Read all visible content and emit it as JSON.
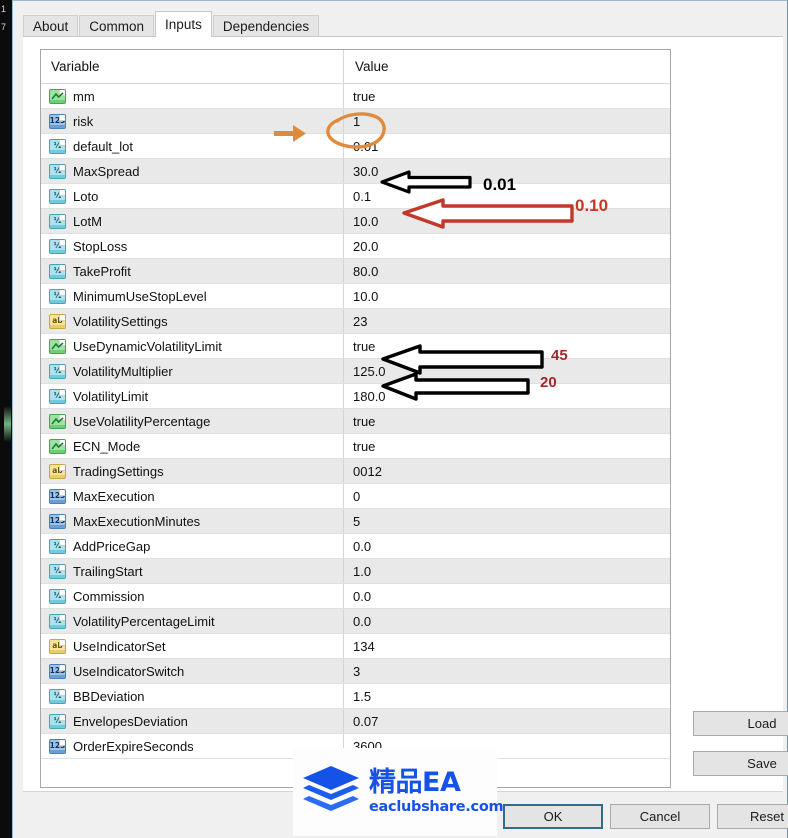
{
  "window": {
    "tabs": [
      {
        "label": "About",
        "active": false
      },
      {
        "label": "Common",
        "active": false
      },
      {
        "label": "Inputs",
        "active": true
      },
      {
        "label": "Dependencies",
        "active": false
      }
    ]
  },
  "table": {
    "headers": {
      "variable": "Variable",
      "value": "Value"
    },
    "rows": [
      {
        "icon": "bool-type-icon",
        "type": "bool",
        "variable": "mm",
        "value": "true"
      },
      {
        "icon": "int-type-icon",
        "type": "int",
        "variable": "risk",
        "value": "1"
      },
      {
        "icon": "double-type-icon",
        "type": "double",
        "variable": "default_lot",
        "value": "0.01"
      },
      {
        "icon": "double-type-icon",
        "type": "double",
        "variable": "MaxSpread",
        "value": "30.0"
      },
      {
        "icon": "double-type-icon",
        "type": "double",
        "variable": "Loto",
        "value": "0.1"
      },
      {
        "icon": "double-type-icon",
        "type": "double",
        "variable": "LotM",
        "value": "10.0"
      },
      {
        "icon": "double-type-icon",
        "type": "double",
        "variable": "StopLoss",
        "value": "20.0"
      },
      {
        "icon": "double-type-icon",
        "type": "double",
        "variable": "TakeProfit",
        "value": "80.0"
      },
      {
        "icon": "double-type-icon",
        "type": "double",
        "variable": "MinimumUseStopLevel",
        "value": "10.0"
      },
      {
        "icon": "string-type-icon",
        "type": "string",
        "variable": "VolatilitySettings",
        "value": "23"
      },
      {
        "icon": "bool-type-icon",
        "type": "bool",
        "variable": "UseDynamicVolatilityLimit",
        "value": "true"
      },
      {
        "icon": "double-type-icon",
        "type": "double",
        "variable": "VolatilityMultiplier",
        "value": "125.0"
      },
      {
        "icon": "double-type-icon",
        "type": "double",
        "variable": "VolatilityLimit",
        "value": "180.0"
      },
      {
        "icon": "bool-type-icon",
        "type": "bool",
        "variable": "UseVolatilityPercentage",
        "value": "true"
      },
      {
        "icon": "bool-type-icon",
        "type": "bool",
        "variable": "ECN_Mode",
        "value": "true"
      },
      {
        "icon": "string-type-icon",
        "type": "string",
        "variable": "TradingSettings",
        "value": "0012"
      },
      {
        "icon": "int-type-icon",
        "type": "int",
        "variable": "MaxExecution",
        "value": "0"
      },
      {
        "icon": "int-type-icon",
        "type": "int",
        "variable": "MaxExecutionMinutes",
        "value": "5"
      },
      {
        "icon": "double-type-icon",
        "type": "double",
        "variable": "AddPriceGap",
        "value": "0.0"
      },
      {
        "icon": "double-type-icon",
        "type": "double",
        "variable": "TrailingStart",
        "value": "1.0"
      },
      {
        "icon": "double-type-icon",
        "type": "double",
        "variable": "Commission",
        "value": "0.0"
      },
      {
        "icon": "double-type-icon",
        "type": "double",
        "variable": "VolatilityPercentageLimit",
        "value": "0.0"
      },
      {
        "icon": "string-type-icon",
        "type": "string",
        "variable": "UseIndicatorSet",
        "value": "134"
      },
      {
        "icon": "int-type-icon",
        "type": "int",
        "variable": "UseIndicatorSwitch",
        "value": "3"
      },
      {
        "icon": "double-type-icon",
        "type": "double",
        "variable": "BBDeviation",
        "value": "1.5"
      },
      {
        "icon": "double-type-icon",
        "type": "double",
        "variable": "EnvelopesDeviation",
        "value": "0.07"
      },
      {
        "icon": "int-type-icon",
        "type": "int",
        "variable": "OrderExpireSeconds",
        "value": "3600"
      }
    ]
  },
  "buttons": {
    "load": "Load",
    "save": "Save",
    "ok": "OK",
    "cancel": "Cancel",
    "reset": "Reset"
  },
  "annotations": {
    "orange_arrow_target": "default_lot",
    "orange_circle_target": "0.01",
    "black_arrow_label": "0.01",
    "red_arrow_label": "0.10",
    "volatility_multiplier_label": "45",
    "volatility_limit_label": "20"
  },
  "colors": {
    "orange": "#e08b3c",
    "red_arrow": "#c0392b",
    "dark_red_text": "#a3262a",
    "black": "#000000",
    "focus_blue": "#2c6e8f",
    "watermark_blue": "#1452e8"
  },
  "watermark": {
    "brand_cn": "精品EA",
    "url": "eaclubshare.com"
  },
  "chart_backdrop": {
    "price_labels": [
      "1",
      "7"
    ]
  }
}
